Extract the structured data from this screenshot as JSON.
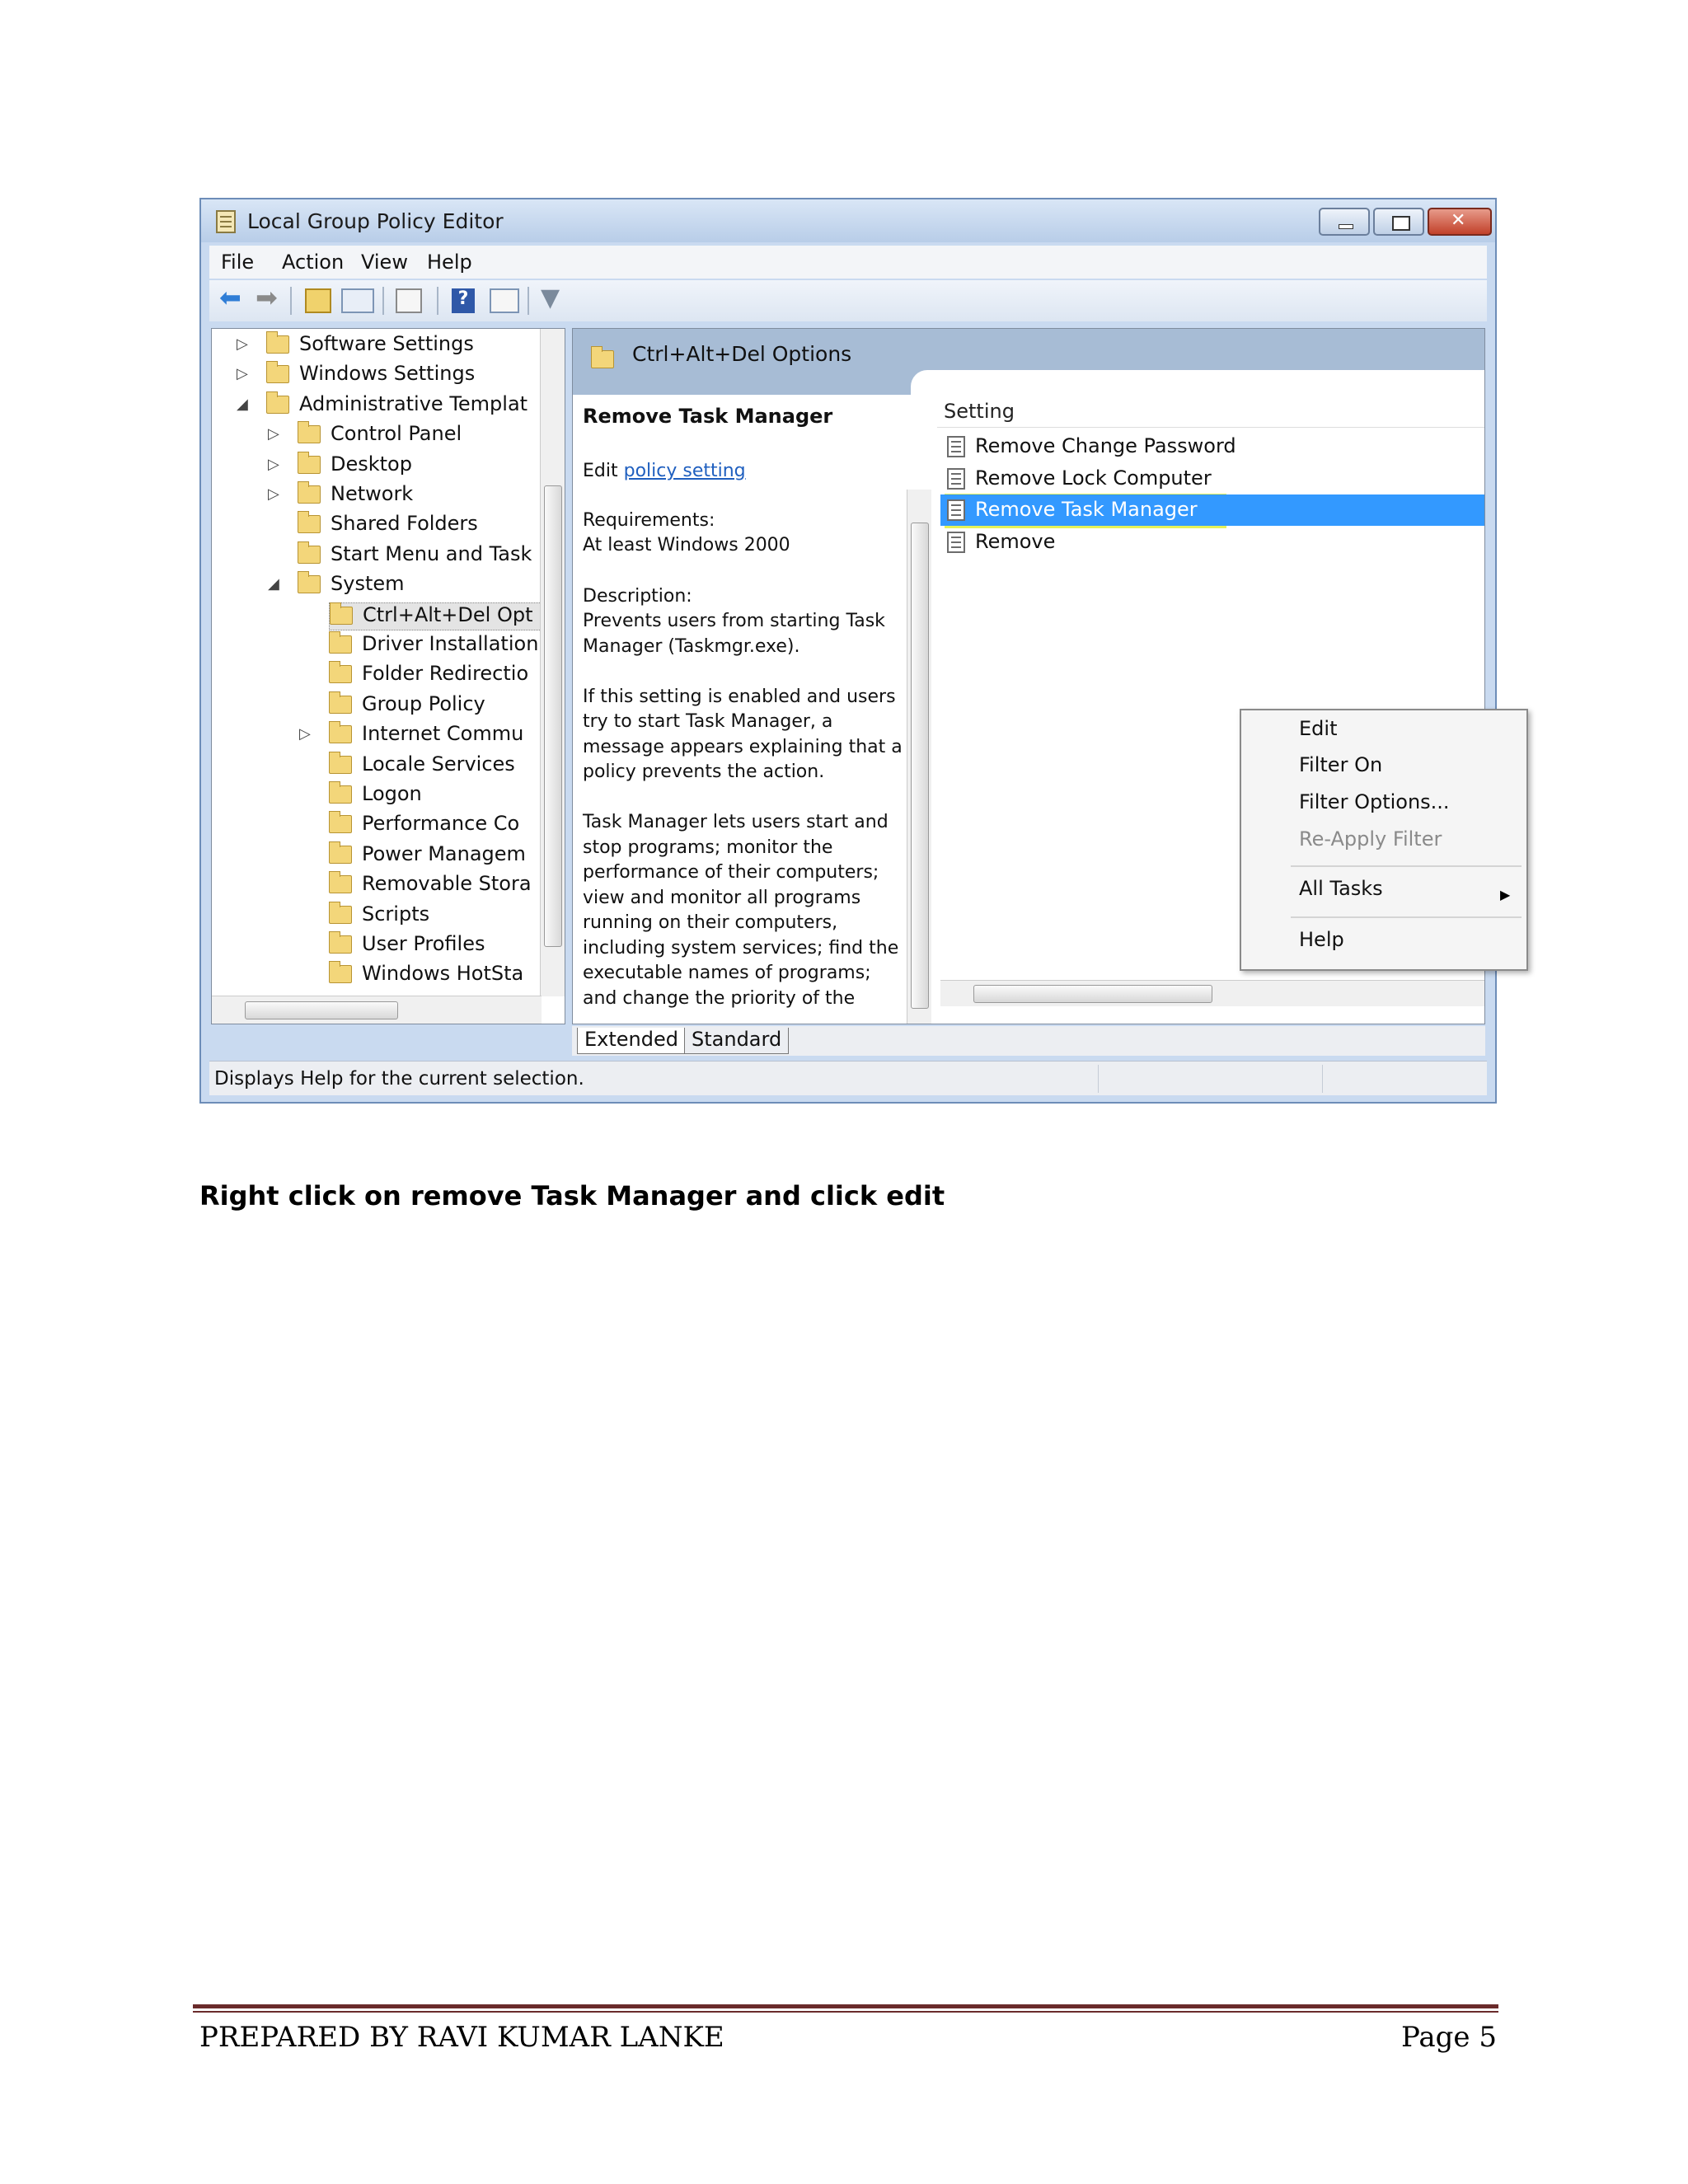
{
  "window": {
    "title": "Local Group Policy Editor",
    "menu": [
      "File",
      "Action",
      "View",
      "Help"
    ]
  },
  "tree": {
    "items": [
      {
        "label": "Software Settings",
        "expander": "▷"
      },
      {
        "label": "Windows Settings",
        "expander": "▷"
      },
      {
        "label": "Administrative Templat",
        "expander": "◢"
      },
      {
        "label": "Control Panel",
        "expander": "▷"
      },
      {
        "label": "Desktop",
        "expander": "▷"
      },
      {
        "label": "Network",
        "expander": "▷"
      },
      {
        "label": "Shared Folders",
        "expander": ""
      },
      {
        "label": "Start Menu and Task",
        "expander": ""
      },
      {
        "label": "System",
        "expander": "◢"
      },
      {
        "label": "Ctrl+Alt+Del Opt",
        "expander": ""
      },
      {
        "label": "Driver Installation",
        "expander": ""
      },
      {
        "label": "Folder Redirectio",
        "expander": ""
      },
      {
        "label": "Group Policy",
        "expander": ""
      },
      {
        "label": "Internet Commu",
        "expander": "▷"
      },
      {
        "label": "Locale Services",
        "expander": ""
      },
      {
        "label": "Logon",
        "expander": ""
      },
      {
        "label": "Performance Co",
        "expander": ""
      },
      {
        "label": "Power Managem",
        "expander": ""
      },
      {
        "label": "Removable Stora",
        "expander": ""
      },
      {
        "label": "Scripts",
        "expander": ""
      },
      {
        "label": "User Profiles",
        "expander": ""
      },
      {
        "label": "Windows HotSta",
        "expander": ""
      }
    ]
  },
  "right_header": {
    "title": "Ctrl+Alt+Del Options"
  },
  "description": {
    "heading": "Remove Task Manager",
    "edit_prefix": "Edit",
    "edit_link": "policy setting",
    "requirements_label": "Requirements:",
    "requirements_value": "At least Windows 2000",
    "description_label": "Description:",
    "lines": [
      "Prevents users from starting Task",
      "Manager (Taskmgr.exe).",
      "",
      "If this setting is enabled and users",
      "try to start Task Manager, a",
      "message appears explaining that a",
      "policy prevents the action.",
      "",
      "Task Manager lets users start and",
      "stop programs; monitor the",
      "performance of their computers;",
      "view and monitor all programs",
      "running on their computers,",
      "including system services; find the",
      "executable names of programs;",
      "and change the priority of the"
    ]
  },
  "settings": {
    "column_header": "Setting",
    "rows": [
      "Remove Change Password",
      "Remove Lock Computer",
      "Remove Task Manager",
      "Remove"
    ]
  },
  "context_menu": {
    "items": [
      "Edit",
      "Filter On",
      "Filter Options...",
      "Re-Apply Filter",
      "All Tasks",
      "Help"
    ]
  },
  "tabs": [
    "Extended",
    "Standard"
  ],
  "status": {
    "text": "Displays Help for the current selection."
  },
  "document": {
    "instruction": "Right click on remove Task Manager and click edit",
    "footer_left": "PREPARED BY RAVI KUMAR LANKE",
    "footer_right": "Page 5"
  }
}
